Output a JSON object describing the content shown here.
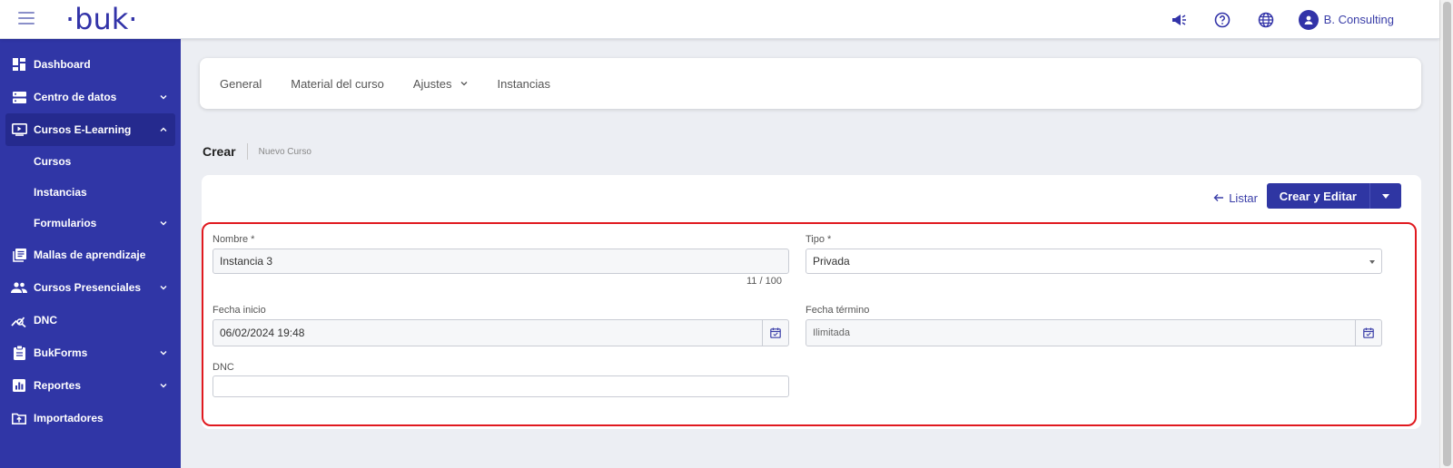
{
  "header": {
    "logo": "·buk·",
    "user_name": "B. Consulting",
    "icons": [
      "menu-icon",
      "megaphone-icon",
      "help-icon",
      "globe-icon",
      "user-avatar-icon"
    ]
  },
  "sidebar": {
    "items": [
      {
        "label": "Dashboard",
        "icon": "dashboard-icon"
      },
      {
        "label": "Centro de datos",
        "icon": "database-icon"
      },
      {
        "label": "Cursos E-Learning",
        "icon": "video-icon"
      },
      {
        "label": "Mallas de aprendizaje",
        "icon": "library-icon"
      },
      {
        "label": "Cursos Presenciales",
        "icon": "people-icon"
      },
      {
        "label": "DNC",
        "icon": "analytics-icon"
      },
      {
        "label": "BukForms",
        "icon": "clipboard-icon"
      },
      {
        "label": "Reportes",
        "icon": "report-icon"
      },
      {
        "label": "Importadores",
        "icon": "folder-upload-icon"
      }
    ],
    "sub_items": [
      {
        "label": "Cursos"
      },
      {
        "label": "Instancias"
      },
      {
        "label": "Formularios"
      }
    ]
  },
  "tabs": [
    {
      "label": "General"
    },
    {
      "label": "Material del curso"
    },
    {
      "label": "Ajustes"
    },
    {
      "label": "Instancias"
    }
  ],
  "breadcrumb": {
    "title": "Crear",
    "subtitle": "Nuevo Curso"
  },
  "actions": {
    "listar_label": "Listar",
    "primary_label": "Crear y Editar"
  },
  "form": {
    "nombre": {
      "label": "Nombre *",
      "value": "Instancia 3",
      "counter": "11 / 100"
    },
    "tipo": {
      "label": "Tipo *",
      "value": "Privada"
    },
    "fecha_inicio": {
      "label": "Fecha inicio",
      "value": "06/02/2024 19:48"
    },
    "fecha_termino": {
      "label": "Fecha término",
      "value": "Ilimitada"
    },
    "dnc": {
      "label": "DNC",
      "value": ""
    }
  },
  "colors": {
    "sidebar_bg": "#3036a6",
    "brand": "#3233a8",
    "highlight": "#e0191f",
    "page_bg": "#eceef3"
  }
}
